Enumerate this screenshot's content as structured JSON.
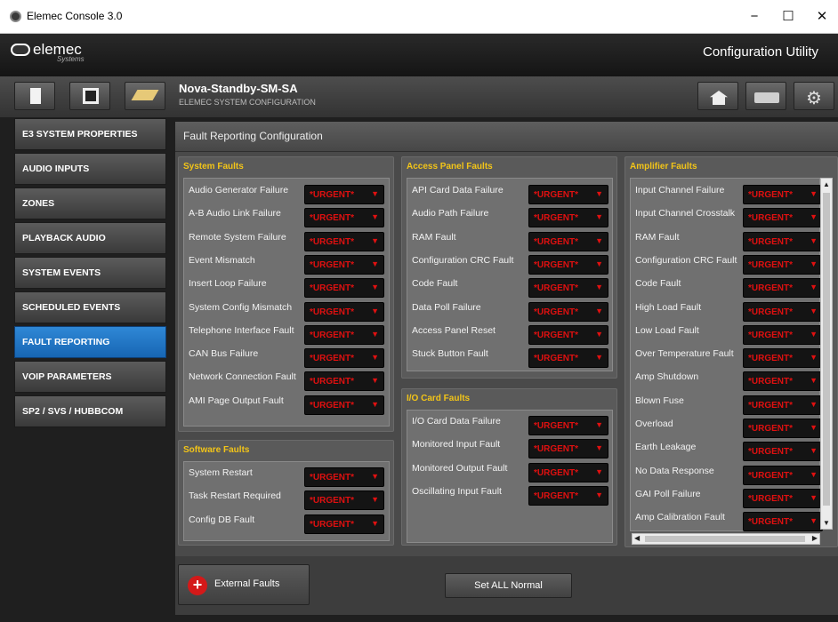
{
  "window": {
    "title": "Elemec Console 3.0",
    "minimize": "−",
    "maximize": "☐",
    "close": "✕"
  },
  "header": {
    "logo": "elemec",
    "logo_sub": "Systems",
    "title": "Configuration Utility"
  },
  "toolbar": {
    "new_icon": "new-document-icon",
    "save_icon": "save-disk-icon",
    "clear_icon": "eraser-icon",
    "home_icon": "home-icon",
    "print_icon": "printer-icon",
    "settings_icon": "gears-icon",
    "gear_glyph": "⚙"
  },
  "project": {
    "name": "Nova-Standby-SM-SA",
    "subtitle": "ELEMEC SYSTEM CONFIGURATION"
  },
  "nav": [
    "E3 SYSTEM PROPERTIES",
    "AUDIO INPUTS",
    "ZONES",
    "PLAYBACK AUDIO",
    "SYSTEM EVENTS",
    "SCHEDULED EVENTS",
    "FAULT REPORTING",
    "VOIP PARAMETERS",
    "SP2 / SVS / HUBBCOM"
  ],
  "nav_active": "FAULT REPORTING",
  "main": {
    "title": "Fault Reporting Configuration"
  },
  "priority_value": "*URGENT*",
  "dropdown_arrow": "▼",
  "groups": {
    "system": {
      "title": "System Faults",
      "items": [
        "Audio Generator Failure",
        "A-B Audio Link Failure",
        "Remote System Failure",
        "Event Mismatch",
        "Insert Loop Failure",
        "System Config Mismatch",
        "Telephone Interface Fault",
        "CAN Bus Failure",
        "Network Connection Fault",
        "AMI Page Output Fault"
      ]
    },
    "software": {
      "title": "Software Faults",
      "items": [
        "System Restart",
        "Task Restart Required",
        "Config DB Fault"
      ]
    },
    "access": {
      "title": "Access Panel Faults",
      "items": [
        "API Card Data Failure",
        "Audio Path Failure",
        "RAM Fault",
        "Configuration CRC Fault",
        "Code Fault",
        "Data Poll Failure",
        "Access Panel Reset",
        "Stuck Button Fault"
      ]
    },
    "io": {
      "title": "I/O Card Faults",
      "items": [
        "I/O Card Data Failure",
        "Monitored Input Fault",
        "Monitored Output Fault",
        "Oscillating Input Fault"
      ]
    },
    "amp": {
      "title": "Amplifier Faults",
      "items": [
        "Input Channel Failure",
        "Input Channel Crosstalk",
        "RAM Fault",
        "Configuration CRC Fault",
        "Code Fault",
        "High Load Fault",
        "Low Load Fault",
        "Over Temperature Fault",
        "Amp Shutdown",
        "Blown Fuse",
        "Overload",
        "Earth Leakage",
        "No Data Response",
        "GAI Poll Failure",
        "Amp Calibration Fault"
      ]
    }
  },
  "buttons": {
    "external_faults": "External Faults",
    "set_all_normal": "Set ALL Normal",
    "plus": "+"
  },
  "scroll": {
    "up": "▲",
    "down": "▼",
    "left": "◀",
    "right": "▶"
  },
  "colors": {
    "urgent": "#e01010",
    "group_title": "#f2c418",
    "nav_active": "#1f77c8"
  }
}
